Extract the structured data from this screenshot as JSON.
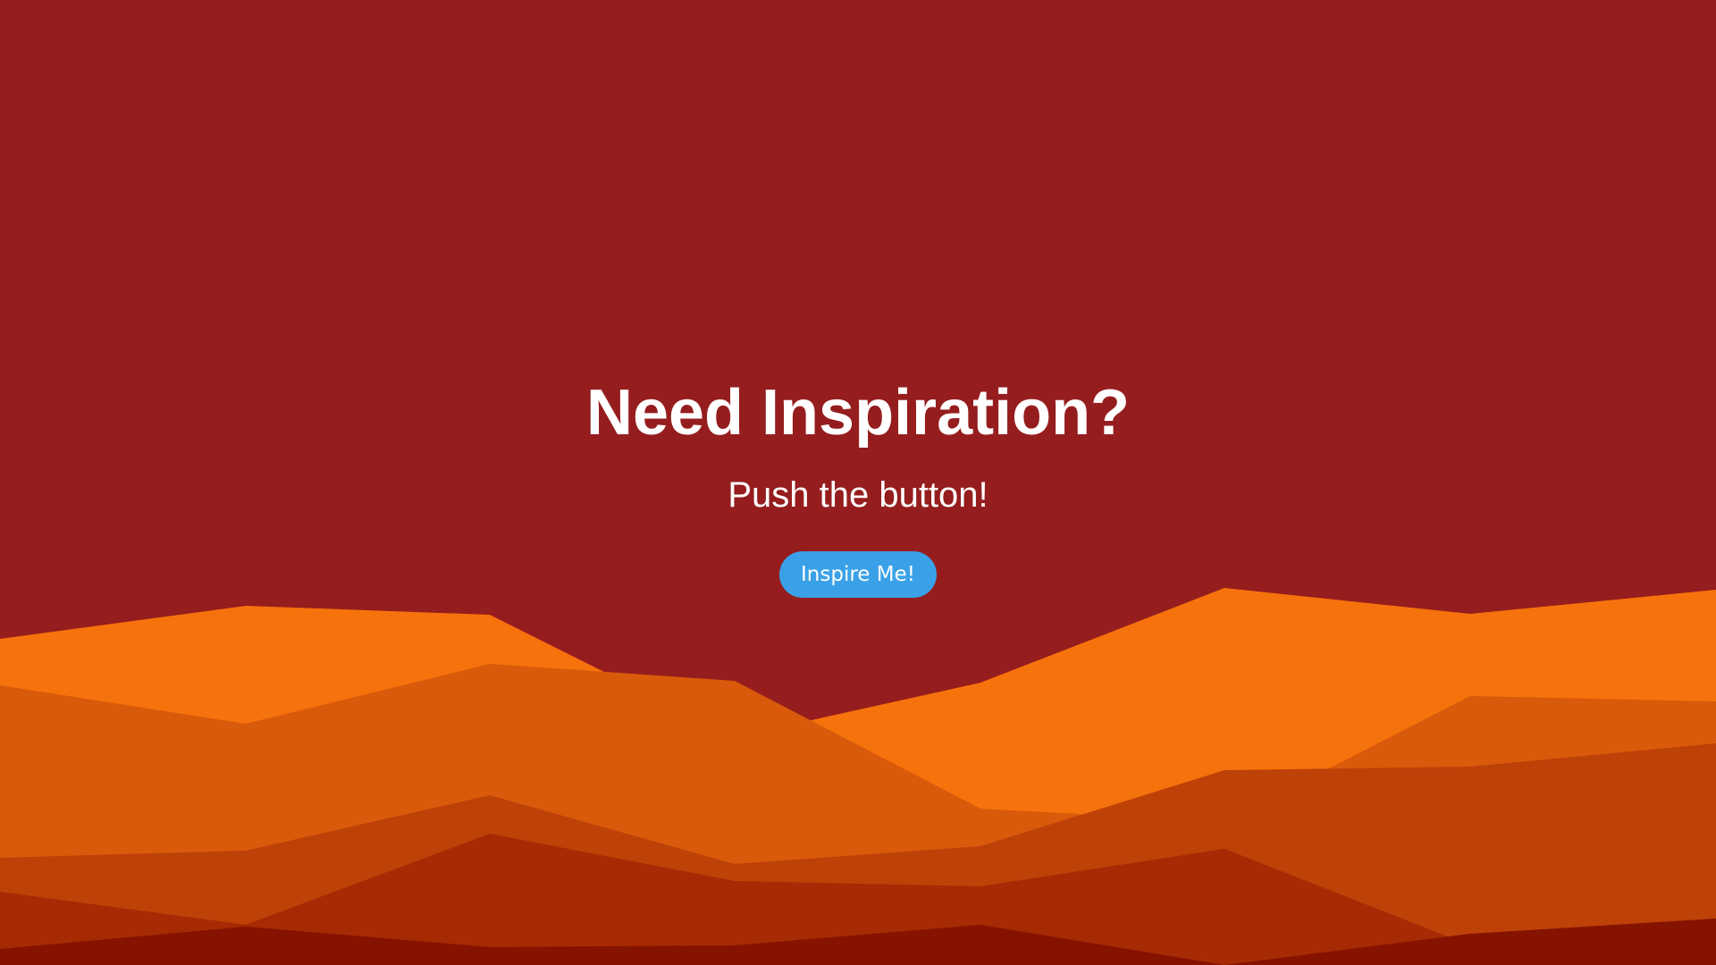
{
  "hero": {
    "title": "Need Inspiration?",
    "subtitle": "Push the button!",
    "button_label": "Inspire Me!"
  },
  "colors": {
    "background": "#951d1e",
    "button": "#3aa1e8",
    "text": "#ffffff",
    "mountain_layers": [
      "#f6720c",
      "#d95a0a",
      "#be4108",
      "#a62a03",
      "#851300"
    ]
  }
}
